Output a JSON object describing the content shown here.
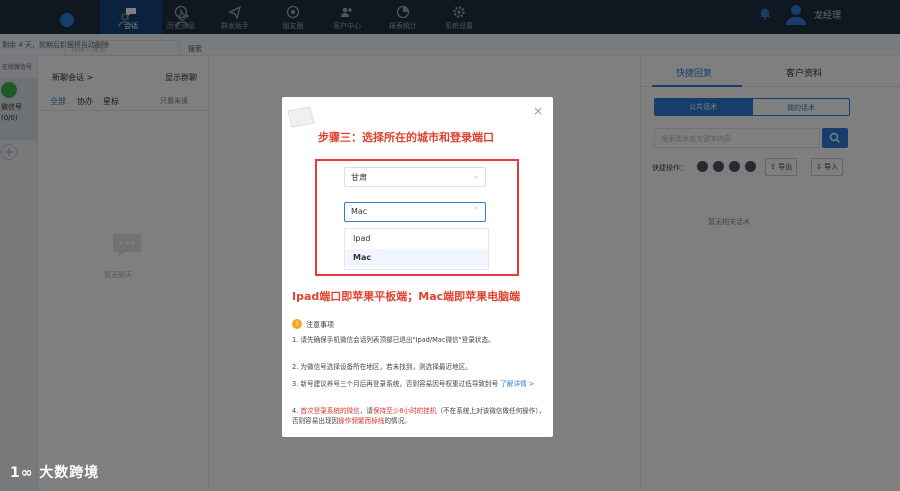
{
  "nav": {
    "items": [
      {
        "label": "会话",
        "icon": "chat-bubble-icon"
      },
      {
        "label": "历史消息",
        "icon": "clock-icon"
      },
      {
        "label": "群发助手",
        "icon": "send-icon"
      },
      {
        "label": "朋友圈",
        "icon": "aperture-icon"
      },
      {
        "label": "客户中心",
        "icon": "users-icon"
      },
      {
        "label": "报表统计",
        "icon": "pie-chart-icon"
      },
      {
        "label": "系统设置",
        "icon": "gear-icon"
      }
    ],
    "user_name": "龙经理"
  },
  "notice": "剩余 4 天，到期后数据将自动删除",
  "left": {
    "title": "在线微信号",
    "account_name": "微信号",
    "account_count": "(0/0)"
  },
  "conversations": {
    "search_placeholder": "请输入搜索",
    "search_button": "搜索",
    "new_chat": "新聊会话 >",
    "mark_read": "显示群聊",
    "tabs": [
      "全部",
      "协办",
      "星标"
    ],
    "only_unread": "只看未读",
    "empty": "暂无聊天"
  },
  "right": {
    "tab_quick_reply": "快捷回复",
    "tab_customer_info": "客户资料",
    "seg_public": "公共话术",
    "seg_mine": "我的话术",
    "search_placeholder": "搜索话术或关键字内容",
    "quick_ops": "快捷操作：",
    "export": "导出",
    "import": "导入",
    "empty": "暂无相关话术"
  },
  "modal": {
    "step_title": "步骤三：选择所在的城市和登录端口",
    "city_value": "甘肃",
    "port_value": "Mac",
    "options": [
      "Ipad",
      "Mac"
    ],
    "highlight": "Ipad端口即苹果平板端；Mac端即苹果电脑端",
    "notes_title": "注意事项",
    "note1": "1. 请先确保手机微信会话列表顶部已退出\"Ipad/Mac微信\"登录状态。",
    "note2": "2. 为微信号选择设备所在地区，若未找到，则选择最近地区。",
    "note3a": "3. 新号建议养号三个月后再登录系统，否则容易因号权重过低导致封号",
    "note3b": "了解详情 >",
    "note4a": "4. ",
    "note4b": "首次登录系统的微信",
    "note4c": "，请",
    "note4d": "保持至少8小时的挂机",
    "note4e": "（不在系统上对该微信做任何操作），否则容易出现因",
    "note4f": "操作频繁而掉线",
    "note4g": "的情况。"
  },
  "watermark": "大数跨境"
}
